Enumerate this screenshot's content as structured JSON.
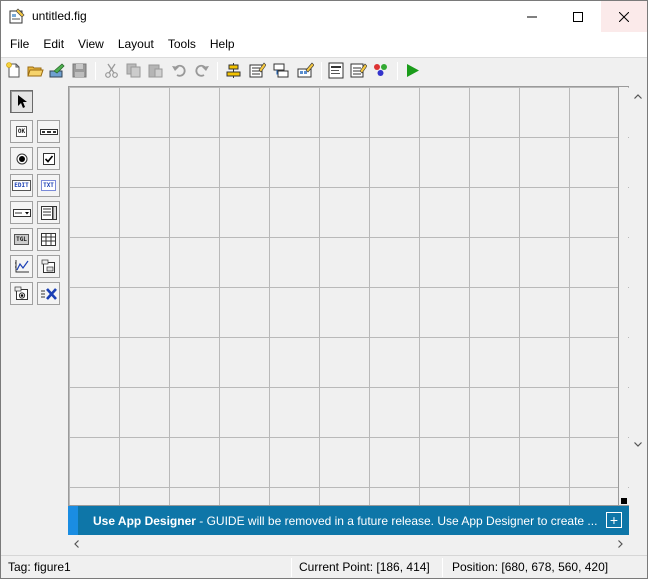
{
  "window": {
    "title": "untitled.fig"
  },
  "menu": [
    "File",
    "Edit",
    "View",
    "Layout",
    "Tools",
    "Help"
  ],
  "toolbar": {
    "tools": [
      "new-figure-icon",
      "open-file-icon",
      "edit-icon",
      "save-icon",
      "cut-icon",
      "copy-icon",
      "paste-icon",
      "undo-icon",
      "redo-icon",
      "align-objects-icon",
      "menu-editor-icon",
      "tab-order-editor-icon",
      "toolbar-editor-icon",
      "editor-icon",
      "property-inspector-icon",
      "object-browser-icon",
      "run-figure-icon"
    ]
  },
  "palette": {
    "items": [
      "select-arrow",
      "push-button",
      "slider",
      "radio-button",
      "check-box",
      "edit-text",
      "static-text",
      "pop-up-menu",
      "list-box",
      "toggle-button",
      "table",
      "axes",
      "panel",
      "button-group",
      "activex-control"
    ],
    "labels": {
      "ok": "OK",
      "edit": "EDIT",
      "txt": "TXT",
      "tgl": "TGL"
    }
  },
  "banner": {
    "bold": "Use App Designer",
    "text": " - GUIDE will be removed in a future release. Use App Designer to create ...",
    "expand": "+"
  },
  "status": {
    "tag": "Tag: figure1",
    "current_point": "Current Point:  [186, 414]",
    "position": "Position: [680, 678, 560, 420]"
  },
  "colors": {
    "banner": "#0e76a8",
    "banner_accent": "#1a8de2",
    "run": "#1a9c1a"
  }
}
